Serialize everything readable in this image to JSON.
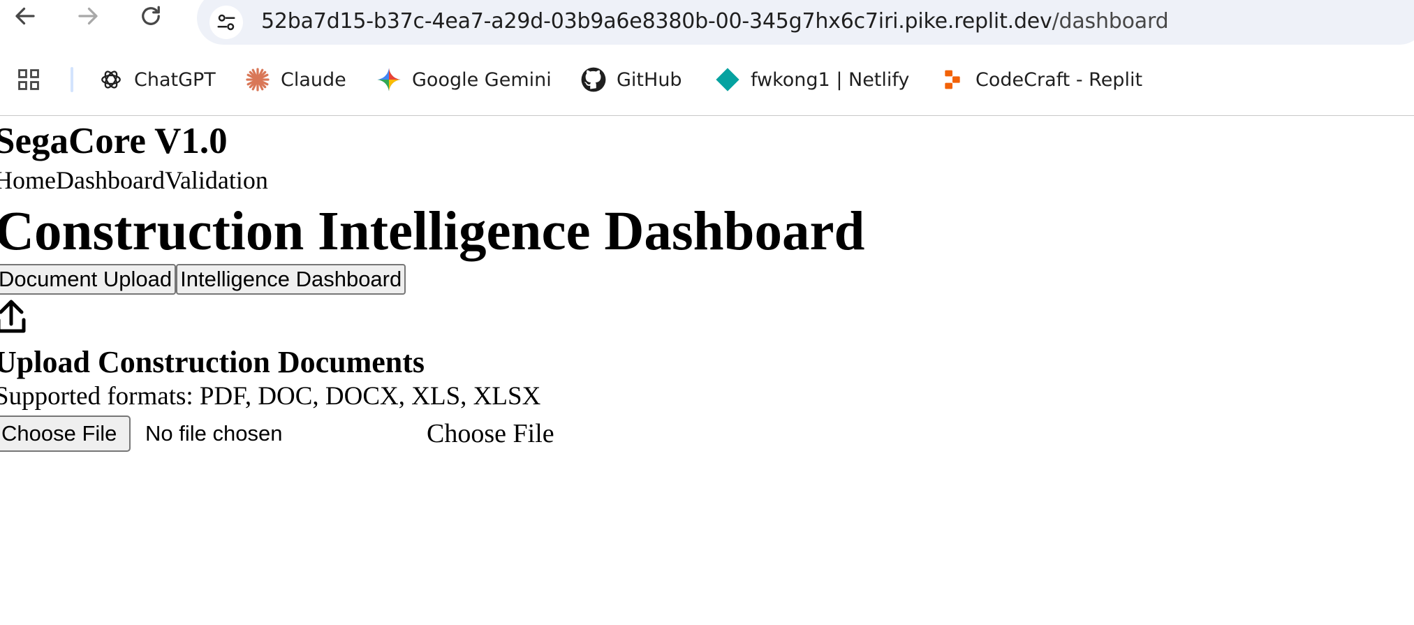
{
  "browser": {
    "url_host": "52ba7d15-b37c-4ea7-a29d-03b9a6e8380b-00-345g7hx6c7iri.pike.replit.dev",
    "url_path": "/dashboard",
    "back_icon": "arrow-left-icon",
    "forward_icon": "arrow-right-icon",
    "reload_icon": "reload-icon",
    "site_info_icon": "tune-icon",
    "bookmarks": [
      {
        "label": "ChatGPT",
        "icon": "chatgpt-icon"
      },
      {
        "label": "Claude",
        "icon": "claude-icon"
      },
      {
        "label": "Google Gemini",
        "icon": "gemini-icon"
      },
      {
        "label": "GitHub",
        "icon": "github-icon"
      },
      {
        "label": "fwkong1 | Netlify",
        "icon": "netlify-icon"
      },
      {
        "label": "CodeCraft - Replit",
        "icon": "replit-icon"
      }
    ],
    "colors": {
      "omnibox_bg": "#eef1f8",
      "claude": "#d97757",
      "netlify": "#05a2a0",
      "replit": "#f26207",
      "separator": "#d3e3fd"
    }
  },
  "app": {
    "title": "SegaCore V1.0",
    "nav": [
      "Home",
      "Dashboard",
      "Validation"
    ],
    "page_title": "Construction Intelligence Dashboard",
    "tabs": [
      "Document Upload",
      "Intelligence Dashboard"
    ],
    "upload": {
      "icon": "upload-icon",
      "heading": "Upload Construction Documents",
      "formats_text": "Supported formats: PDF, DOC, DOCX, XLS, XLSX",
      "file_button": "Choose File",
      "file_status": "No file chosen",
      "choose_label": "Choose File"
    }
  }
}
